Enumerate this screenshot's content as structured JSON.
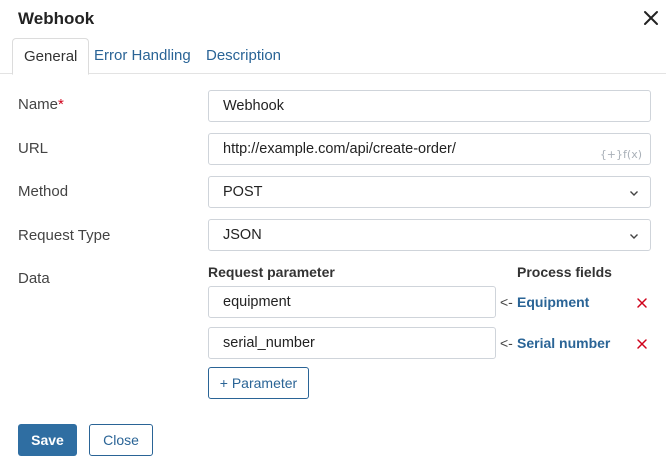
{
  "dialog": {
    "title": "Webhook",
    "close_icon": "close-icon"
  },
  "tabs": [
    {
      "label": "General",
      "active": true
    },
    {
      "label": "Error Handling",
      "active": false
    },
    {
      "label": "Description",
      "active": false
    }
  ],
  "form": {
    "name": {
      "label": "Name",
      "required_mark": "*",
      "value": "Webhook"
    },
    "url": {
      "label": "URL",
      "value": "http://example.com/api/create-order/",
      "expression_icon": "{+}f(x)"
    },
    "method": {
      "label": "Method",
      "value": "POST"
    },
    "request_type": {
      "label": "Request Type",
      "value": "JSON"
    },
    "data": {
      "label": "Data",
      "col_request_parameter": "Request parameter",
      "col_process_fields": "Process fields",
      "rows": [
        {
          "parameter": "equipment",
          "arrow": "<-",
          "field": "Equipment"
        },
        {
          "parameter": "serial_number",
          "arrow": "<-",
          "field": "Serial number"
        }
      ],
      "add_parameter_label": "+ Parameter"
    }
  },
  "footer": {
    "save_label": "Save",
    "close_label": "Close"
  },
  "colors": {
    "accent": "#2a6496",
    "primary_button": "#2f6ea2",
    "delete": "#d0021b"
  }
}
